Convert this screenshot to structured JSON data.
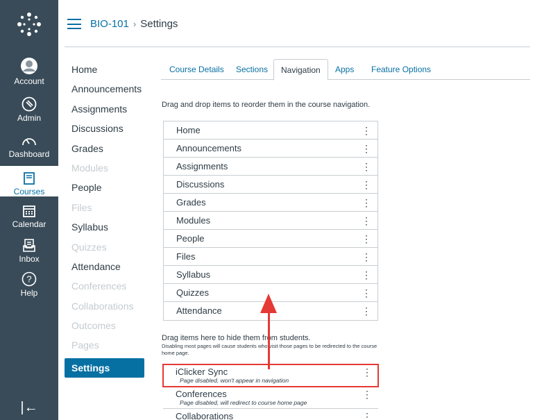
{
  "global_nav": {
    "items": [
      {
        "label": "Account",
        "icon": "account-icon"
      },
      {
        "label": "Admin",
        "icon": "admin-icon"
      },
      {
        "label": "Dashboard",
        "icon": "dashboard-icon"
      },
      {
        "label": "Courses",
        "icon": "courses-icon",
        "active": true
      },
      {
        "label": "Calendar",
        "icon": "calendar-icon"
      },
      {
        "label": "Inbox",
        "icon": "inbox-icon"
      },
      {
        "label": "Help",
        "icon": "help-icon"
      }
    ],
    "collapse_glyph": "|←"
  },
  "header": {
    "course": "BIO-101",
    "separator": "›",
    "current": "Settings"
  },
  "course_nav": {
    "items": [
      {
        "label": "Home",
        "state": "enabled"
      },
      {
        "label": "Announcements",
        "state": "enabled"
      },
      {
        "label": "Assignments",
        "state": "enabled"
      },
      {
        "label": "Discussions",
        "state": "enabled"
      },
      {
        "label": "Grades",
        "state": "enabled"
      },
      {
        "label": "Modules",
        "state": "disabled"
      },
      {
        "label": "People",
        "state": "enabled"
      },
      {
        "label": "Files",
        "state": "disabled"
      },
      {
        "label": "Syllabus",
        "state": "enabled"
      },
      {
        "label": "Quizzes",
        "state": "disabled"
      },
      {
        "label": "Attendance",
        "state": "enabled"
      },
      {
        "label": "Conferences",
        "state": "disabled"
      },
      {
        "label": "Collaborations",
        "state": "disabled"
      },
      {
        "label": "Outcomes",
        "state": "disabled"
      },
      {
        "label": "Pages",
        "state": "disabled"
      },
      {
        "label": "Settings",
        "state": "active"
      }
    ]
  },
  "tabs": [
    {
      "label": "Course Details"
    },
    {
      "label": "Sections"
    },
    {
      "label": "Navigation",
      "active": true
    },
    {
      "label": "Apps"
    },
    {
      "label": "Feature Options"
    }
  ],
  "navigation": {
    "instructions": "Drag and drop items to reorder them in the course navigation.",
    "enabled_items": [
      "Home",
      "Announcements",
      "Assignments",
      "Discussions",
      "Grades",
      "Modules",
      "People",
      "Files",
      "Syllabus",
      "Quizzes",
      "Attendance"
    ],
    "hide_title": "Drag items here to hide them from students.",
    "hide_note": "Disabling most pages will cause students who visit those pages to be redirected to the course home page.",
    "hidden_items": [
      {
        "label": "iClicker Sync",
        "note": "Page disabled, won't appear in navigation",
        "highlighted": true
      },
      {
        "label": "Conferences",
        "note": "Page disabled, will redirect to course home page"
      },
      {
        "label": "Collaborations",
        "note": ""
      }
    ],
    "kebab_glyph": "⋮"
  },
  "colors": {
    "global_nav_bg": "#394b58",
    "link": "#0770a3",
    "annotation": "#e53935"
  }
}
